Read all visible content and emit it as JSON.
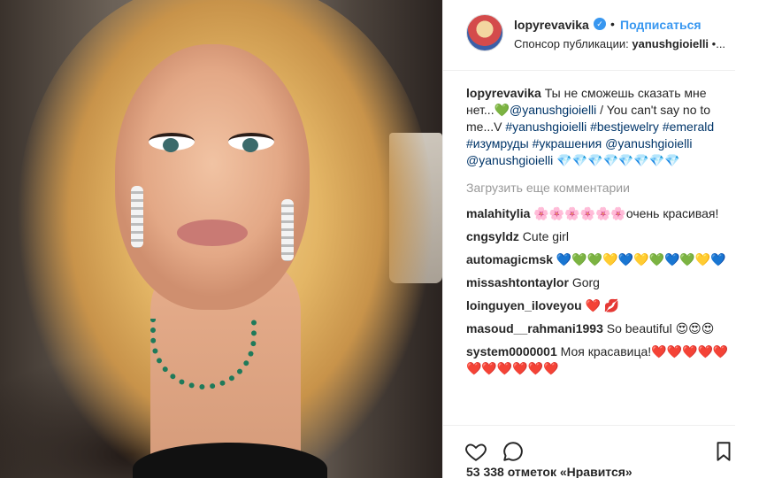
{
  "post": {
    "username": "lopyrevavika",
    "follow_label": "Подписаться",
    "separator": "•",
    "sponsor_prefix": "Спонсор публикации:",
    "sponsor_name": "yanushgioielli",
    "sponsor_suffix": " •..."
  },
  "caption": {
    "username": "lopyrevavika",
    "text_1": " Ты не сможешь сказать мне нет...💚",
    "mention_1": "@yanushgioielli",
    "text_2": " / You can't say no to me...V ",
    "tag_1": "#yanushgioielli",
    "tag_2": "#bestjewelry",
    "tag_3": "#emerald",
    "tag_4": "#изумруды",
    "tag_5": "#украшения",
    "mention_2": "@yanushgioielli",
    "mention_3": "@yanushgioielli",
    "emoji_tail": " 💎💎💎💎💎💎💎💎"
  },
  "load_more": "Загрузить еще комментарии",
  "comments": [
    {
      "user": "malahitylia",
      "text": " 🌸🌸🌸🌸🌸🌸очень красивая!"
    },
    {
      "user": "cngsyldz",
      "text": " Cute girl"
    },
    {
      "user": "automagicmsk",
      "text": " 💙💚💚💛💙💛💚💙💚💛💙"
    },
    {
      "user": "missashtontaylor",
      "text": " Gorg"
    },
    {
      "user": "loinguyen_iloveyou",
      "text": " ❤️ 💋"
    },
    {
      "user": "masoud__rahmani1993",
      "text": " So beautiful 😍😍😍"
    },
    {
      "user": "system0000001",
      "text": " Моя красавица!❤️❤️❤️❤️❤️❤️❤️❤️❤️❤️❤️"
    }
  ],
  "likes": "53 338 отметок «Нравится»",
  "icons": [
    "heart-icon",
    "comment-icon",
    "bookmark-icon",
    "verified-badge-icon"
  ],
  "colors": {
    "link": "#3897f0",
    "hashtag": "#003569",
    "muted": "#999999",
    "text": "#262626"
  }
}
